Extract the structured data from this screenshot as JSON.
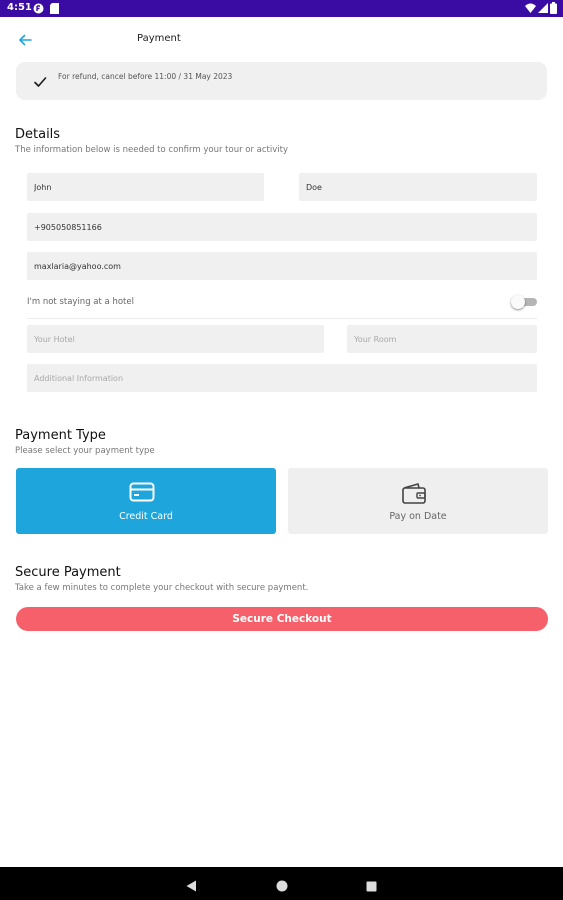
{
  "status_bar": {
    "time": "4:51"
  },
  "header": {
    "title": "Payment"
  },
  "notice": {
    "text": "For refund, cancel before 11:00 / 31 May 2023"
  },
  "details": {
    "title": "Details",
    "subtitle": "The information below is needed to confirm your tour or activity",
    "first_name": "John",
    "last_name": "Doe",
    "phone": "+905050851166",
    "email": "maxlaria@yahoo.com",
    "hotel_toggle_label": "I'm not staying at a hotel",
    "hotel_toggle_on": false,
    "hotel_placeholder": "Your Hotel",
    "room_placeholder": "Your Room",
    "additional_placeholder": "Additional Information"
  },
  "payment_type": {
    "title": "Payment Type",
    "subtitle": "Please select your payment type",
    "options": [
      {
        "label": "Credit Card",
        "icon": "credit-card-icon",
        "selected": true
      },
      {
        "label": "Pay on Date",
        "icon": "wallet-icon",
        "selected": false
      }
    ]
  },
  "secure_payment": {
    "title": "Secure Payment",
    "subtitle": "Take a few minutes to complete your checkout with secure payment.",
    "button_label": "Secure Checkout"
  },
  "colors": {
    "status_bar": "#3a0ca3",
    "accent_blue": "#1ea5dc",
    "checkout_red": "#f5606b",
    "field_bg": "#f0f0f0"
  }
}
